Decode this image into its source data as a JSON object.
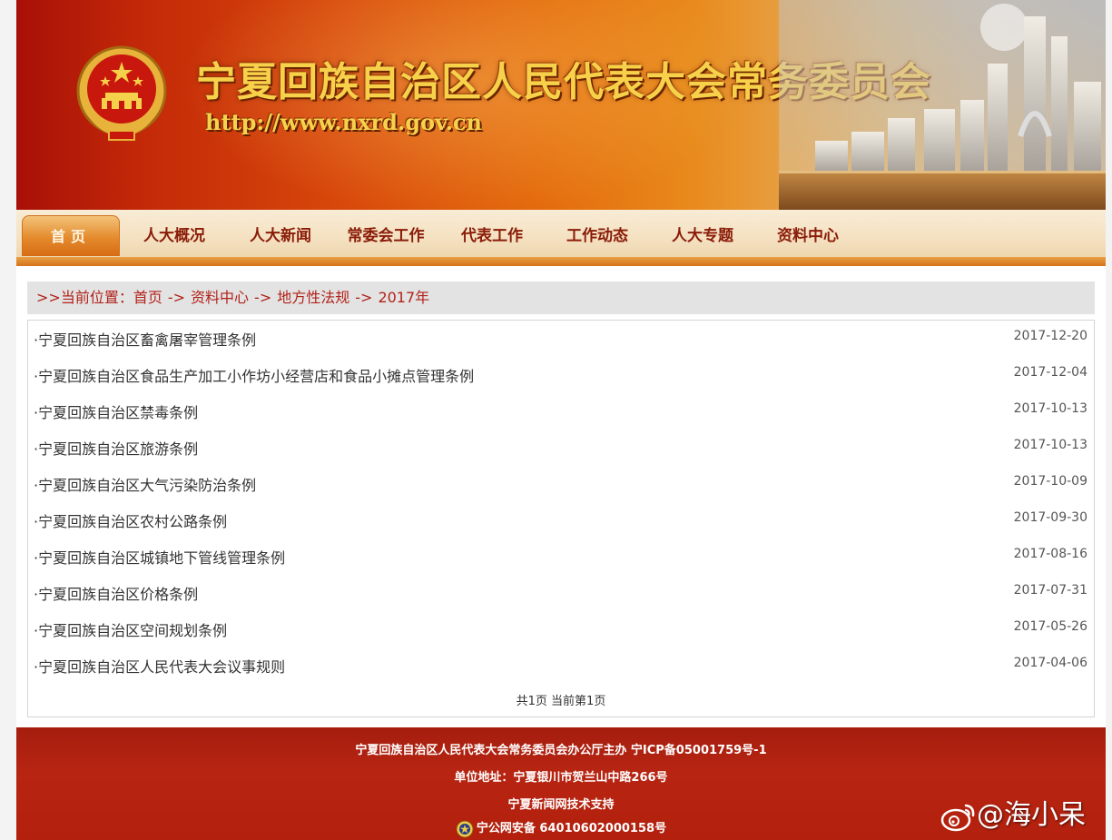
{
  "header": {
    "site_title": "宁夏回族自治区人民代表大会常务委员会",
    "site_url": "http://www.nxrd.gov.cn"
  },
  "nav": {
    "items": [
      {
        "label": "首页",
        "active": true
      },
      {
        "label": "人大概况"
      },
      {
        "label": "人大新闻"
      },
      {
        "label": "常委会工作"
      },
      {
        "label": "代表工作"
      },
      {
        "label": "工作动态"
      },
      {
        "label": "人大专题"
      },
      {
        "label": "资料中心"
      }
    ]
  },
  "breadcrumb": {
    "prefix": ">>当前位置：",
    "crumbs": [
      "首页",
      "资料中心",
      "地方性法规",
      "2017年"
    ],
    "separator": "->"
  },
  "list": {
    "items": [
      {
        "title": "·宁夏回族自治区畜禽屠宰管理条例",
        "date": "2017-12-20"
      },
      {
        "title": "·宁夏回族自治区食品生产加工小作坊小经营店和食品小摊点管理条例",
        "date": "2017-12-04"
      },
      {
        "title": "·宁夏回族自治区禁毒条例",
        "date": "2017-10-13"
      },
      {
        "title": "·宁夏回族自治区旅游条例",
        "date": "2017-10-13"
      },
      {
        "title": "·宁夏回族自治区大气污染防治条例",
        "date": "2017-10-09"
      },
      {
        "title": "·宁夏回族自治区农村公路条例",
        "date": "2017-09-30"
      },
      {
        "title": "·宁夏回族自治区城镇地下管线管理条例",
        "date": "2017-08-16"
      },
      {
        "title": "·宁夏回族自治区价格条例",
        "date": "2017-07-31"
      },
      {
        "title": "·宁夏回族自治区空间规划条例",
        "date": "2017-05-26"
      },
      {
        "title": "·宁夏回族自治区人民代表大会议事规则",
        "date": "2017-04-06"
      }
    ],
    "pager": "共1页 当前第1页"
  },
  "footer": {
    "line1": "宁夏回族自治区人民代表大会常务委员会办公厅主办 宁ICP备05001759号-1",
    "line2": "单位地址：宁夏银川市贺兰山中路266号",
    "line3": "宁夏新闻网技术支持",
    "line4": "宁公网安备 64010602000158号"
  },
  "watermark": {
    "text": "@海小呆"
  },
  "colors": {
    "banner_red": "#a81008",
    "banner_orange": "#e46a0c",
    "title_gold": "#f8d14a",
    "nav_text": "#8a1c08",
    "breadcrumb_text": "#b1221a",
    "footer_red": "#b3200d"
  }
}
